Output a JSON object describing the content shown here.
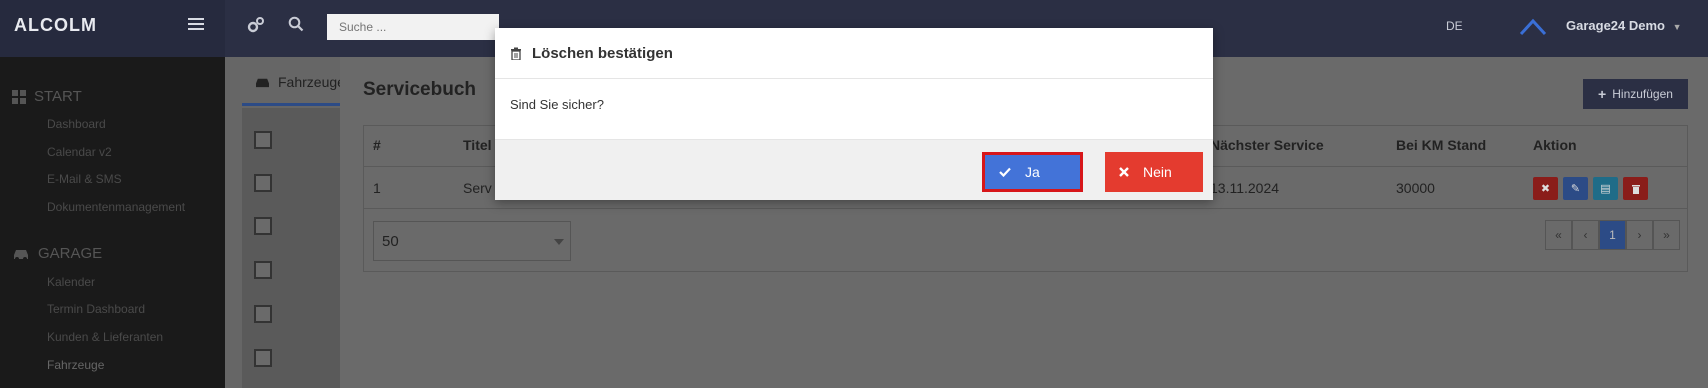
{
  "topbar": {
    "brand": "ALCOLM",
    "search_placeholder": "Suche ...",
    "language": "DE",
    "user_name": "Garage24 Demo"
  },
  "sidebar": {
    "sections": [
      {
        "label": "START",
        "items": [
          "Dashboard",
          "Calendar v2",
          "E-Mail & SMS",
          "Dokumentenmanagement"
        ]
      },
      {
        "label": "GARAGE",
        "items": [
          "Kalender",
          "Termin Dashboard",
          "Kunden & Lieferanten",
          "Fahrzeuge"
        ]
      }
    ]
  },
  "main": {
    "tab_label": "Fahrzeuge",
    "title": "Servicebuch",
    "add_button": "Hinzufügen",
    "table": {
      "headers": [
        "#",
        "Titel",
        "Nächster Service",
        "Bei KM Stand",
        "Aktion"
      ],
      "rows": [
        {
          "num": "1",
          "titel": "Serv",
          "next_service": "13.11.2024",
          "km": "30000"
        }
      ]
    },
    "page_size": "50",
    "pagination": [
      "«",
      "‹",
      "1",
      "›",
      "»"
    ]
  },
  "modal": {
    "title": "Löschen bestätigen",
    "body": "Sind Sie sicher?",
    "confirm_label": "Ja",
    "cancel_label": "Nein"
  },
  "colors": {
    "topbar": "#2b2f44",
    "confirm": "#4373d8",
    "confirm_focus_border": "#d7161a",
    "cancel": "#e43b2f"
  }
}
